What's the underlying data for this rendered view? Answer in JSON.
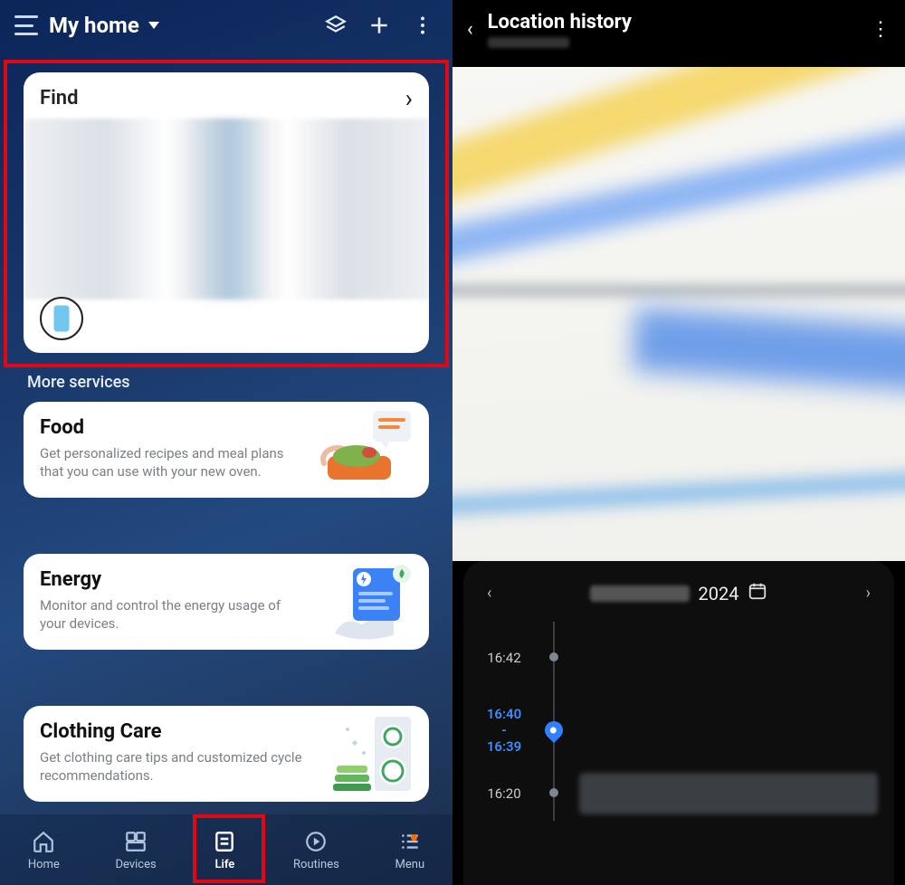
{
  "left": {
    "header": {
      "title": "My home"
    },
    "find_card": {
      "title": "Find"
    },
    "more_services_label": "More services",
    "services": [
      {
        "title": "Food",
        "desc": "Get personalized recipes and meal plans that you can use with your new oven."
      },
      {
        "title": "Energy",
        "desc": "Monitor and control the energy usage of your devices."
      },
      {
        "title": "Clothing Care",
        "desc": "Get clothing care tips and customized cycle recommendations."
      }
    ],
    "nav": {
      "items": [
        {
          "label": "Home"
        },
        {
          "label": "Devices"
        },
        {
          "label": "Life"
        },
        {
          "label": "Routines"
        },
        {
          "label": "Menu"
        }
      ],
      "active_index": 2,
      "menu_badge": true
    }
  },
  "right": {
    "title": "Location history",
    "date_year": "2024",
    "timeline": [
      {
        "time": "16:42",
        "active": false
      },
      {
        "time_start": "16:40",
        "time_sep": "-",
        "time_end": "16:39",
        "active": true
      },
      {
        "time": "16:20",
        "active": false
      }
    ]
  }
}
